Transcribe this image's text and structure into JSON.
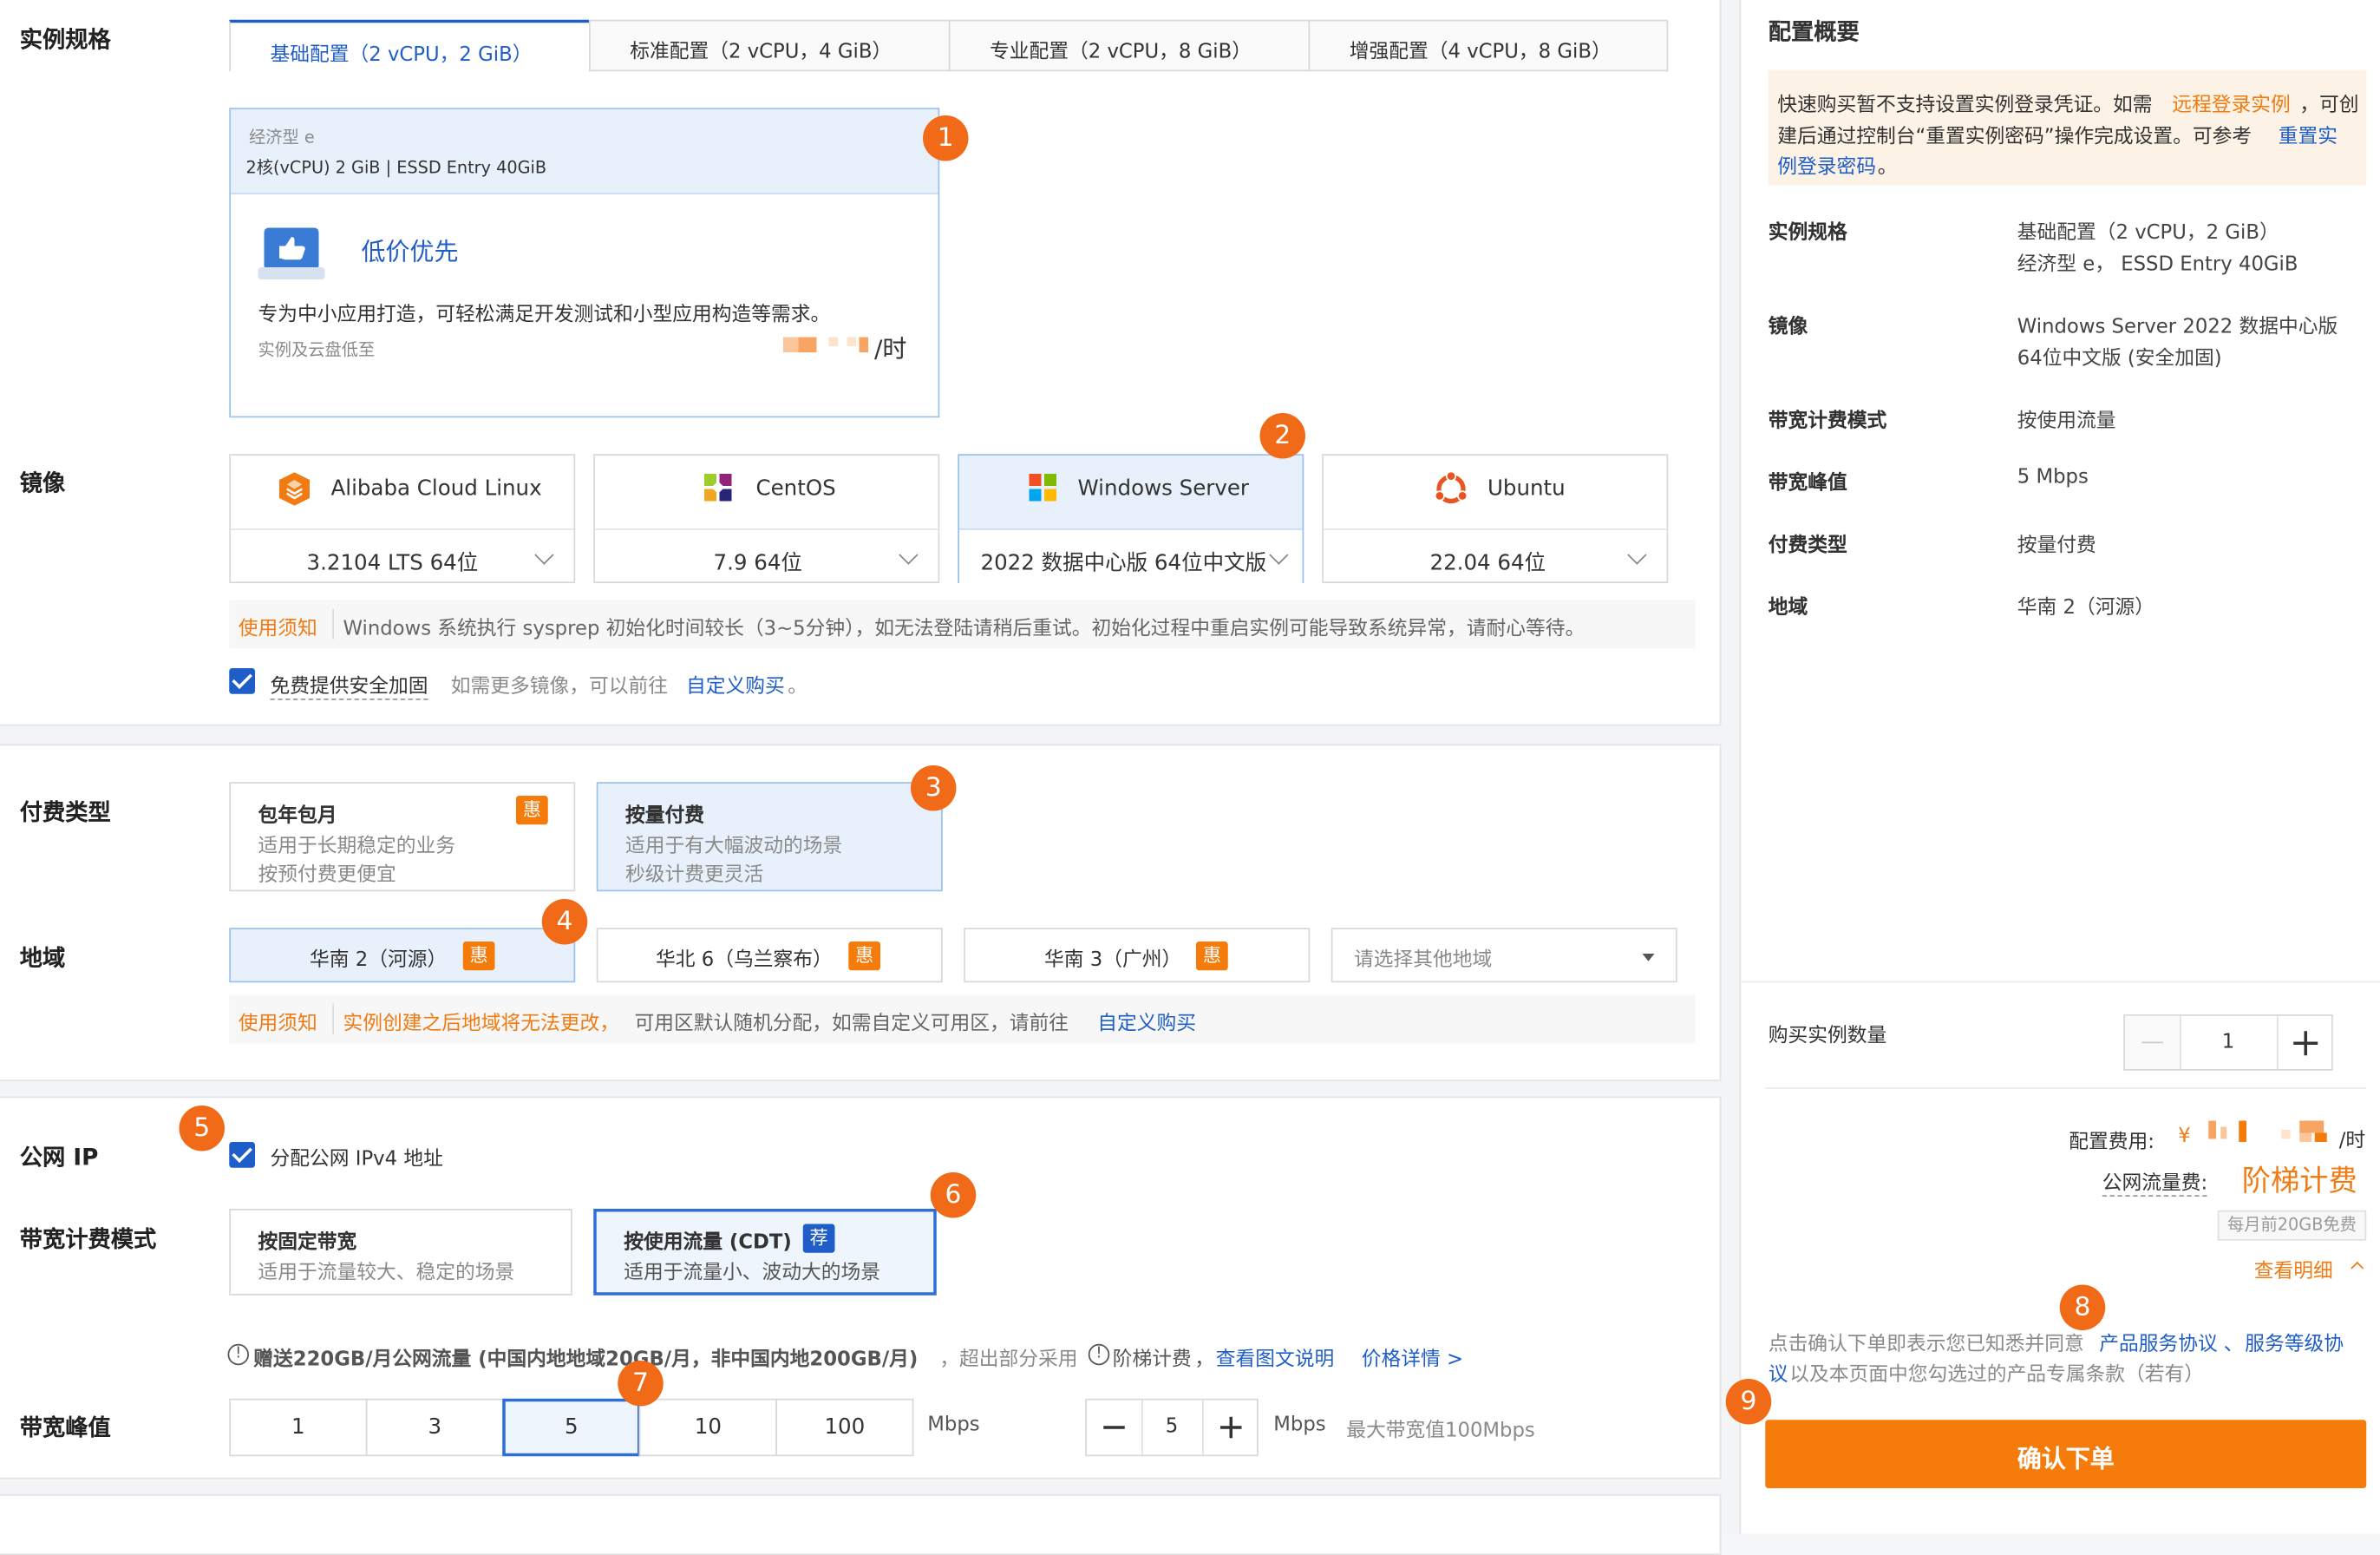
{
  "spec": {
    "label": "实例规格",
    "tabs": [
      "基础配置（2 vCPU，2 GiB）",
      "标准配置（2 vCPU，4 GiB）",
      "专业配置（2 vCPU，8 GiB）",
      "增强配置（4 vCPU，8 GiB）"
    ],
    "card_type": "经济型 e",
    "card_detail": "2核(vCPU) 2 GiB | ESSD Entry 40GiB",
    "card_title": "低价优先",
    "card_desc": "专为中小应用打造，可轻松满足开发测试和小型应用构造等需求。",
    "card_note": "实例及云盘低至",
    "card_unit": "/时"
  },
  "image": {
    "label": "镜像",
    "options": [
      {
        "name": "Alibaba Cloud Linux",
        "version": "3.2104 LTS 64位"
      },
      {
        "name": "CentOS",
        "version": "7.9 64位"
      },
      {
        "name": "Windows Server",
        "version": "2022 数据中心版 64位中文版"
      },
      {
        "name": "Ubuntu",
        "version": "22.04 64位"
      }
    ],
    "notice_tag": "使用须知",
    "notice_text": "Windows 系统执行 sysprep 初始化时间较长（3~5分钟），如无法登陆请稍后重试。初始化过程中重启实例可能导致系统异常，请耐心等待。",
    "security_label": "免费提供安全加固",
    "more_text": "如需更多镜像，可以前往",
    "more_link": "自定义购买",
    "more_end": "。"
  },
  "billing": {
    "label": "付费类型",
    "options": [
      {
        "title": "包年包月",
        "line1": "适用于长期稳定的业务",
        "line2": "按预付费更便宜",
        "badge": "惠"
      },
      {
        "title": "按量付费",
        "line1": "适用于有大幅波动的场景",
        "line2": "秒级计费更灵活"
      }
    ]
  },
  "region": {
    "label": "地域",
    "options": [
      "华南 2（河源）",
      "华北 6（乌兰察布）",
      "华南 3（广州）"
    ],
    "badge": "惠",
    "placeholder": "请选择其他地域",
    "notice_tag": "使用须知",
    "notice_warn": "实例创建之后地域将无法更改，",
    "notice_text": "可用区默认随机分配，如需自定义可用区，请前往",
    "notice_link": "自定义购买"
  },
  "network": {
    "ip_label": "公网 IP",
    "ip_check": "分配公网 IPv4 地址",
    "bw_mode_label": "带宽计费模式",
    "modes": [
      {
        "title": "按固定带宽",
        "desc": "适用于流量较大、稳定的场景"
      },
      {
        "title": "按使用流量 (CDT)",
        "desc": "适用于流量小、波动大的场景",
        "badge": "荐"
      }
    ],
    "free_text": "赠送220GB/月公网流量 (中国内地地域20GB/月，非中国内地200GB/月)",
    "free_text2": "，超出部分采用",
    "tier_text": "阶梯计费",
    "tier_comma": "，",
    "view_link": "查看图文说明",
    "price_link": "价格详情 >",
    "peak_label": "带宽峰值",
    "peak_options": [
      "1",
      "3",
      "5",
      "10",
      "100"
    ],
    "unit": "Mbps",
    "stepper_value": "5",
    "max_text": "最大带宽值100Mbps"
  },
  "summary": {
    "title": "配置概要",
    "warn1": "快速购买暂不支持设置实例登录凭证。如需",
    "warn_link1": "远程登录实例",
    "warn2": "，可创",
    "warn3": "建后通过控制台“重置实例密码”操作完成设置。可参考",
    "warn_link2a": "重置实",
    "warn_link2b": "例登录密码",
    "warn_end": "。",
    "rows": [
      {
        "key": "实例规格",
        "v1": "基础配置（2 vCPU，2 GiB）",
        "v2": "经济型 e， ESSD Entry 40GiB"
      },
      {
        "key": "镜像",
        "v1": "Windows Server 2022 数据中心版",
        "v2": "64位中文版 (安全加固)"
      },
      {
        "key": "带宽计费模式",
        "v1": "按使用流量",
        "v2": ""
      },
      {
        "key": "带宽峰值",
        "v1": "5 Mbps",
        "v2": ""
      },
      {
        "key": "付费类型",
        "v1": "按量付费",
        "v2": ""
      },
      {
        "key": "地域",
        "v1": "华南 2（河源）",
        "v2": ""
      }
    ],
    "qty_label": "购买实例数量",
    "qty_value": "1",
    "fee_label": "配置费用:",
    "fee_currency": "¥",
    "fee_unit": "/时",
    "traffic_label": "公网流量费:",
    "traffic_value": "阶梯计费",
    "free_badge": "每月前20GB免费",
    "detail_link": "查看明细",
    "agree1": "点击确认下单即表示您已知悉并同意",
    "agree_link1": "产品服务协议",
    "agree_sep": "、",
    "agree_link2a": "服务等级协",
    "agree_link2b": "议",
    "agree2": "以及本页面中您勾选过的产品专属条款（若有）",
    "confirm": "确认下单"
  },
  "markers": [
    "1",
    "2",
    "3",
    "4",
    "5",
    "6",
    "7",
    "8",
    "9"
  ],
  "colors": {
    "accent": "#1f5ec9",
    "orange": "#f57b0b",
    "marker": "#f06a17"
  }
}
